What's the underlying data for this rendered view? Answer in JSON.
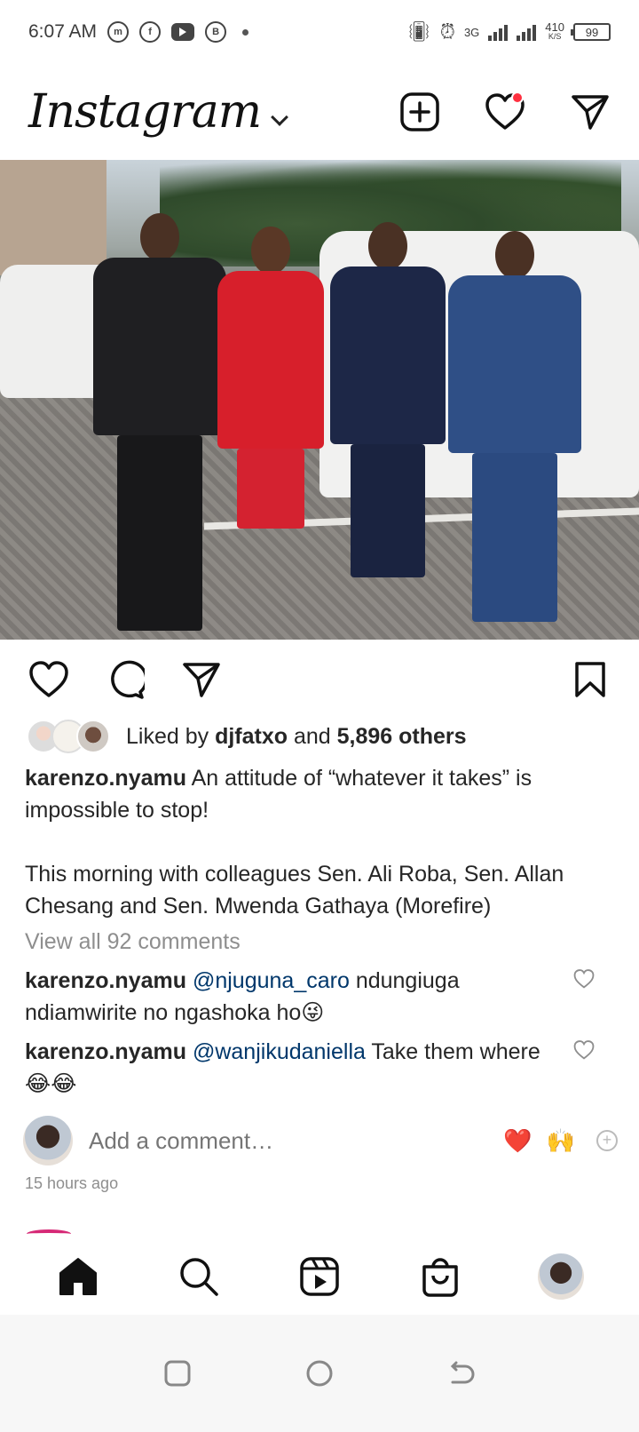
{
  "status_bar": {
    "time": "6:07 AM",
    "net_speed": "410",
    "net_unit": "K/S",
    "network_type": "3G",
    "battery": "99"
  },
  "header": {
    "logo": "Instagram"
  },
  "post": {
    "liked_by_prefix": "Liked by ",
    "liked_by_user": "djfatxo",
    "liked_by_and": " and ",
    "liked_by_others": "5,896 others",
    "author": "karenzo.nyamu",
    "caption": " An attitude of “whatever it takes” is impossible to stop!\n\nThis morning with colleagues Sen. Ali Roba, Sen. Allan Chesang and Sen. Mwenda Gathaya (Morefire)",
    "view_comments": "View all 92 comments",
    "comments": [
      {
        "user": "karenzo.nyamu",
        "mention": "@njuguna_caro",
        "text": " ndungiuga ndiamwirite no ngashoka ho😜"
      },
      {
        "user": "karenzo.nyamu",
        "mention": "@wanjikudaniella",
        "text": " Take them where 😂😂"
      }
    ],
    "add_comment_placeholder": "Add a comment…",
    "quick_emojis": [
      "❤️",
      "🙌"
    ],
    "timestamp": "15 hours ago"
  },
  "colors": {
    "notification": "#ff3040",
    "mention": "#00376b",
    "muted": "#8e8e8e"
  },
  "icons": [
    "new-post-icon",
    "heart-icon",
    "direct-message-icon",
    "comment-icon",
    "share-icon",
    "bookmark-icon",
    "home-icon",
    "search-icon",
    "reels-icon",
    "shop-icon"
  ]
}
